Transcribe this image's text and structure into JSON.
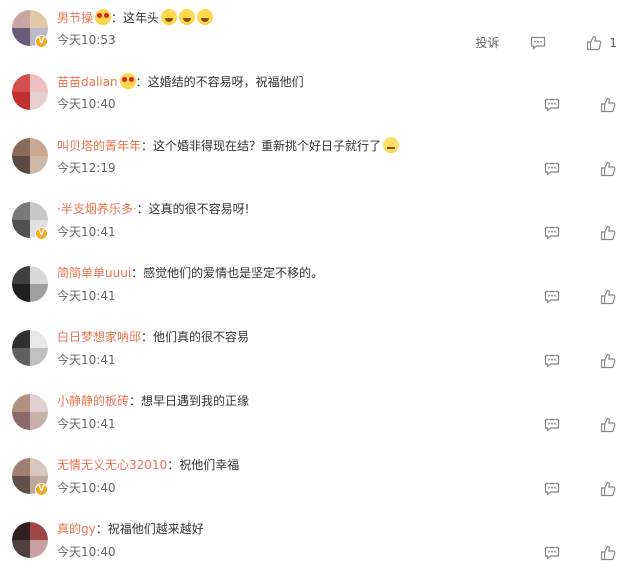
{
  "actions": {
    "report_label": "投诉"
  },
  "comments": [
    {
      "user": "男节操",
      "badge": "V",
      "sep": "：",
      "text": "这年头",
      "time": "今天10:53",
      "likes": "1",
      "emojis": [
        "love",
        "cry",
        "cry",
        "cry"
      ],
      "colors": [
        "#caa6a0",
        "#e0c8a8",
        "#6a5a7a",
        "#b8b8c8"
      ]
    },
    {
      "user": "苗苗dalian",
      "badge": "",
      "sep": "：",
      "text": "这婚结的不容易呀，祝福他们",
      "time": "今天10:40",
      "likes": "",
      "emojis": [
        "love"
      ],
      "colors": [
        "#d45050",
        "#f0c0c0",
        "#c03030",
        "#e8d0d0"
      ]
    },
    {
      "user": "叫贝塔的菁年年",
      "badge": "",
      "sep": "：",
      "text": "这个婚非得现在结？重新挑个好日子就行了",
      "time": "今天12:19",
      "likes": "",
      "emojis": [
        "smirk"
      ],
      "colors": [
        "#8a6a5a",
        "#c8a890",
        "#5a4a40",
        "#d0b8a8"
      ]
    },
    {
      "user": "·半支烟养乐多·",
      "badge": "V",
      "sep": "：",
      "text": "这真的很不容易呀!",
      "time": "今天10:41",
      "likes": "",
      "emojis": [],
      "colors": [
        "#7a7a7a",
        "#c8c8c8",
        "#505050",
        "#e0e0e0"
      ]
    },
    {
      "user": "简简单单uuui",
      "badge": "",
      "sep": "：",
      "text": "感觉他们的爱情也是坚定不移的。",
      "time": "今天10:41",
      "likes": "",
      "emojis": [],
      "colors": [
        "#404040",
        "#d8d8d8",
        "#202020",
        "#a0a0a0"
      ]
    },
    {
      "user": "白日梦想家呐邱",
      "badge": "",
      "sep": "：",
      "text": "他们真的很不容易",
      "time": "今天10:41",
      "likes": "",
      "emojis": [],
      "colors": [
        "#303030",
        "#e8e8e8",
        "#606060",
        "#c0c0c0"
      ]
    },
    {
      "user": "小静静的板砖",
      "badge": "",
      "sep": "：",
      "text": "想早日遇到我的正缘",
      "time": "今天10:41",
      "likes": "",
      "emojis": [],
      "colors": [
        "#b09080",
        "#e0d0d0",
        "#8a6a6a",
        "#c8b0a8"
      ]
    },
    {
      "user": "无情无义无心32010",
      "badge": "V",
      "sep": "：",
      "text": "祝他们幸福",
      "time": "今天10:40",
      "likes": "",
      "emojis": [],
      "colors": [
        "#a08070",
        "#d8c8c0",
        "#605048",
        "#c0a898"
      ]
    },
    {
      "user": "真的gy",
      "badge": "",
      "sep": "：",
      "text": "祝福他们越来越好",
      "time": "今天10:40",
      "likes": "",
      "emojis": [],
      "colors": [
        "#302020",
        "#a04848",
        "#504040",
        "#c8a0a0"
      ]
    }
  ]
}
